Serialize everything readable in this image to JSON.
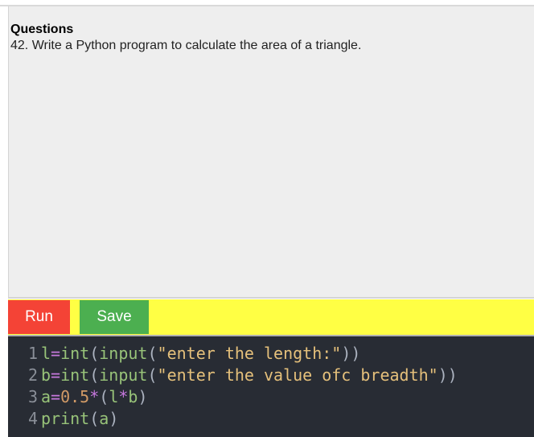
{
  "question": {
    "heading": "Questions",
    "text": "42. Write a Python program to calculate the area of a triangle."
  },
  "toolbar": {
    "run_label": "Run",
    "save_label": "Save"
  },
  "editor": {
    "lines": [
      {
        "number": "1",
        "tokens": [
          "l",
          "=",
          "int",
          "(",
          "input",
          "(",
          "\"enter the length:\"",
          "))"
        ]
      },
      {
        "number": "2",
        "tokens": [
          "b",
          "=",
          "int",
          "(",
          "input",
          "(",
          "\"enter the value ofc breadth\"",
          "))"
        ]
      },
      {
        "number": "3",
        "tokens": [
          "a",
          "=",
          "0.5",
          "*",
          "(",
          "l",
          "*",
          "b",
          ")"
        ]
      },
      {
        "number": "4",
        "tokens": [
          "print",
          "(",
          "a",
          ")"
        ]
      }
    ]
  },
  "colors": {
    "run_button": "#f44336",
    "save_button": "#4caf50",
    "toolbar": "#ffff44",
    "editor_bg": "#282c34"
  }
}
